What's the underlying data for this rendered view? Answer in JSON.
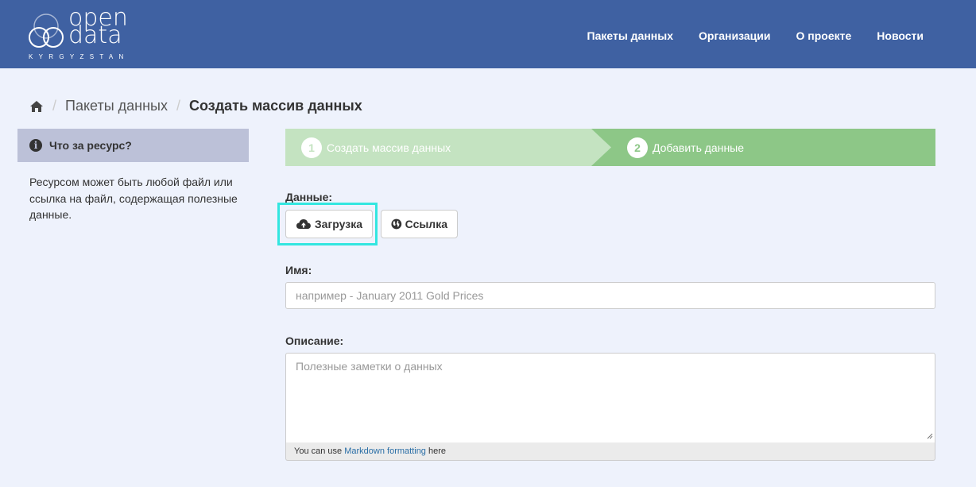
{
  "header": {
    "logo_line1": "open",
    "logo_line2": "data",
    "logo_sub": "KYRGYZSTAN",
    "nav": [
      "Пакеты данных",
      "Организации",
      "О проекте",
      "Новости"
    ]
  },
  "breadcrumb": {
    "items": [
      "Пакеты данных",
      "Создать массив данных"
    ]
  },
  "sidebar": {
    "title": "Что за ресурс?",
    "text": "Ресурсом может быть любой файл или ссылка на файл, содержащая полезные данные."
  },
  "stages": [
    {
      "number": "1",
      "label": "Создать массив данных",
      "state": "complete"
    },
    {
      "number": "2",
      "label": "Добавить данные",
      "state": "active"
    }
  ],
  "form": {
    "data_label": "Данные:",
    "upload_button": "Загрузка",
    "link_button": "Ссылка",
    "name_label": "Имя:",
    "name_placeholder": "например - January 2011 Gold Prices",
    "description_label": "Описание:",
    "description_placeholder": "Полезные заметки о данных",
    "markdown_prefix": "You can use",
    "markdown_link": "Markdown formatting",
    "markdown_suffix": "here"
  },
  "colors": {
    "header_bg": "#3f61a2",
    "page_bg": "#eef2fc",
    "stage_complete": "#c4e3c1",
    "stage_active": "#8dc787",
    "highlight": "#33e6e0"
  }
}
